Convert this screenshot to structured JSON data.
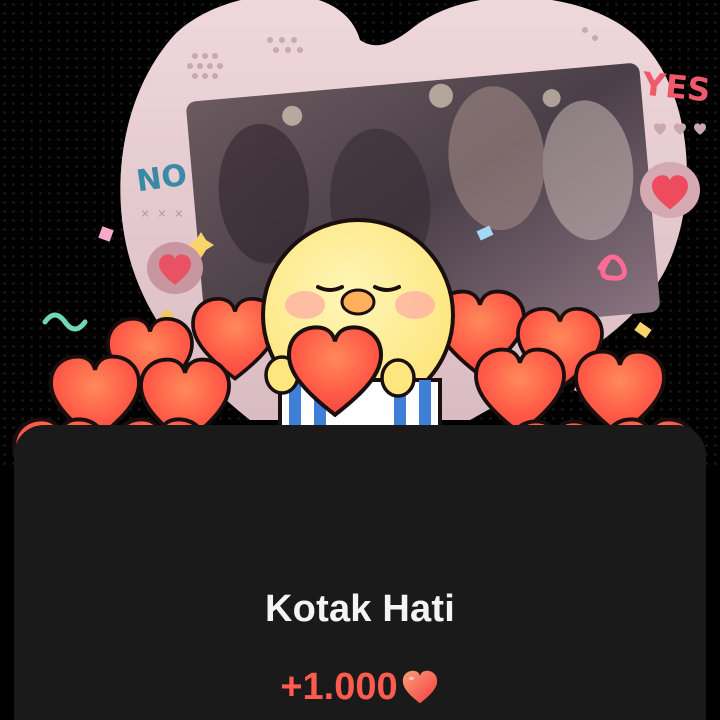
{
  "reward": {
    "title": "Kotak Hati",
    "amount": "+1.000",
    "currency_icon": "heart-icon"
  },
  "photo_frame": {
    "no_label": "NO",
    "yes_label": "YES"
  },
  "colors": {
    "background": "#000000",
    "panel": "#1a1a1a",
    "title_text": "#f4f4f4",
    "amount_text": "#ff5c4f",
    "heart_fill": "#ff5448",
    "frame_pink": "#e8cfd3"
  }
}
